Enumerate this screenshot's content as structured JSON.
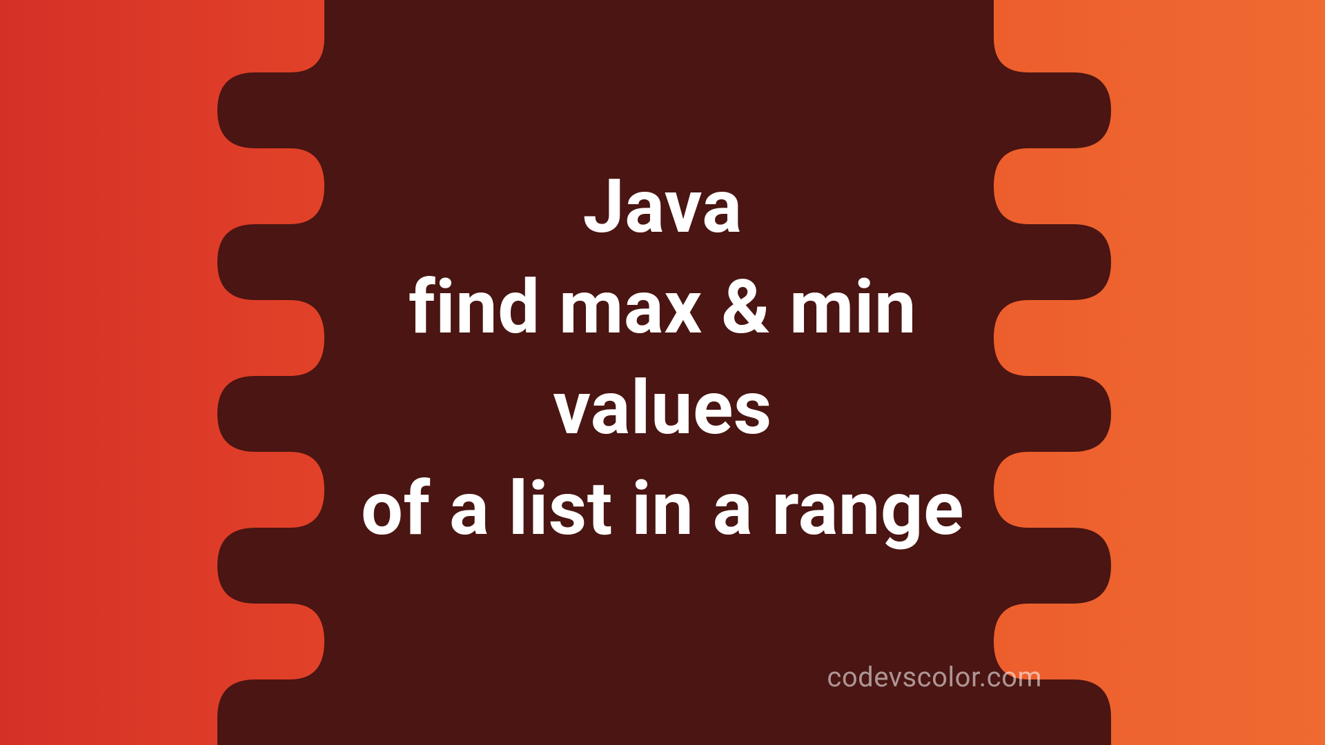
{
  "title": {
    "line1": "Java",
    "line2": "find max & min",
    "line3": "values",
    "line4": "of a list in a range"
  },
  "watermark": "codevscolor.com",
  "colors": {
    "blob": "#4a1512",
    "text": "#ffffff",
    "bg_left": "#d53027",
    "bg_right": "#ee6a31"
  }
}
